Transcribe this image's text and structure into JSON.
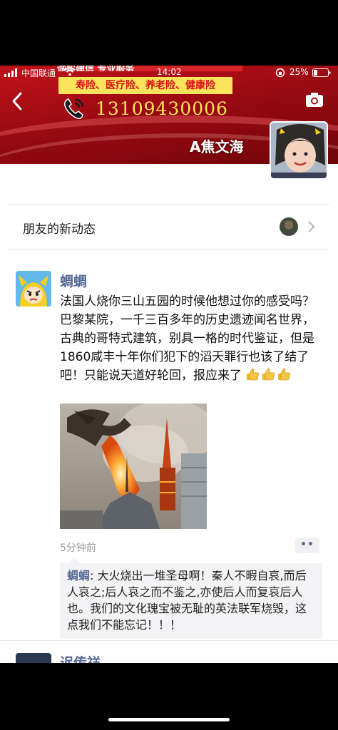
{
  "status_bar": {
    "carrier": "中国联通",
    "time": "14:02",
    "battery": "25%"
  },
  "cover": {
    "banner_top": "诚实建信 专业服务",
    "banner_services": "寿险、医疗险、养老险、健康险",
    "phone_number": "13109430006",
    "owner_name": "A焦文海"
  },
  "notifications": {
    "label": "朋友的新动态"
  },
  "post": {
    "author": "蜩蜩",
    "text": "法国人烧你三山五园的时候他想过你的感受吗？巴黎某院，一千三百多年的历史遗迹闻名世界，古典的哥特式建筑，别具一格的时代鉴证，但是1860咸丰十年你们犯下的滔天罪行也该了结了吧！只能说天道好轮回，报应来了",
    "time": "5分钟前",
    "more_label": "••",
    "comments": [
      {
        "author": "蜩蜩",
        "separator": ": ",
        "text": "大火烧出一堆圣母啊！秦人不暇自哀,而后人哀之;后人哀之而不鉴之,亦使后人而复哀后人也。我们的文化瑰宝被无耻的英法联军烧毁，这点我们不能忘记！！！"
      }
    ]
  },
  "next_post": {
    "author": "迟传祥"
  },
  "icons": {
    "back": "back-chevron-icon",
    "camera": "camera-icon",
    "phone": "phone-icon",
    "thumbs": "thumbs-up-icon"
  },
  "colors": {
    "link_blue": "#576b95",
    "cover_red": "#b50f18",
    "accent_yellow": "#fbe45c"
  }
}
